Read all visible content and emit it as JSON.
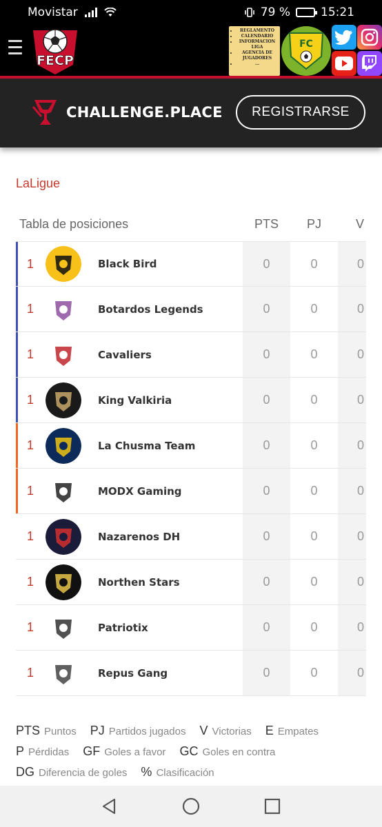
{
  "status_bar": {
    "carrier": "Movistar",
    "battery": "79 %",
    "battery_level": 0.79,
    "time": "15:21"
  },
  "header": {
    "logo_text": "FECP",
    "banner_items": [
      "REGLAMENTO",
      "CALENDARIO",
      "INFORMACION LIGA",
      "AGENCIA DE JUGADORES",
      "..."
    ],
    "badge_text": "FC",
    "brand_color": "#c8102e"
  },
  "challenge": {
    "brand": "CHALLENGE.PLACE",
    "register_label": "REGISTRARSE"
  },
  "league": {
    "title": "LaLigue"
  },
  "table": {
    "title": "Tabla de posiciones",
    "columns": [
      "PTS",
      "PJ",
      "V"
    ],
    "rows": [
      {
        "pos": "1",
        "name": "Black Bird",
        "pts": "0",
        "pj": "0",
        "v": "0",
        "zone_color": "#3f51b5",
        "logo_icon": "bird-crest-icon"
      },
      {
        "pos": "1",
        "name": "Botardos Legends",
        "pts": "0",
        "pj": "0",
        "v": "0",
        "zone_color": "#3f51b5",
        "logo_icon": "crown-crest-icon"
      },
      {
        "pos": "1",
        "name": "Cavaliers",
        "pts": "0",
        "pj": "0",
        "v": "0",
        "zone_color": "#3f51b5",
        "logo_icon": "cavs-crest-icon"
      },
      {
        "pos": "1",
        "name": "King Valkiria",
        "pts": "0",
        "pj": "0",
        "v": "0",
        "zone_color": "#3f51b5",
        "logo_icon": "valkiria-crest-icon"
      },
      {
        "pos": "1",
        "name": "La Chusma Team",
        "pts": "0",
        "pj": "0",
        "v": "0",
        "zone_color": "#f26522",
        "logo_icon": "chusma-crest-icon"
      },
      {
        "pos": "1",
        "name": "MODX Gaming",
        "pts": "0",
        "pj": "0",
        "v": "0",
        "zone_color": "#f26522",
        "logo_icon": "eagle-crest-icon"
      },
      {
        "pos": "1",
        "name": "Nazarenos DH",
        "pts": "0",
        "pj": "0",
        "v": "0",
        "zone_color": "",
        "logo_icon": "nazarenos-crest-icon"
      },
      {
        "pos": "1",
        "name": "Northen Stars",
        "pts": "0",
        "pj": "0",
        "v": "0",
        "zone_color": "",
        "logo_icon": "stars-crest-icon"
      },
      {
        "pos": "1",
        "name": "Patriotix",
        "pts": "0",
        "pj": "0",
        "v": "0",
        "zone_color": "",
        "logo_icon": "patriotix-crest-icon"
      },
      {
        "pos": "1",
        "name": "Repus Gang",
        "pts": "0",
        "pj": "0",
        "v": "0",
        "zone_color": "",
        "logo_icon": "tiger-crest-icon"
      }
    ]
  },
  "legend": [
    {
      "abbr": "PTS",
      "label": "Puntos"
    },
    {
      "abbr": "PJ",
      "label": "Partidos jugados"
    },
    {
      "abbr": "V",
      "label": "Victorias"
    },
    {
      "abbr": "E",
      "label": "Empates"
    },
    {
      "abbr": "P",
      "label": "Pérdidas"
    },
    {
      "abbr": "GF",
      "label": "Goles a favor"
    },
    {
      "abbr": "GC",
      "label": "Goles en contra"
    },
    {
      "abbr": "DG",
      "label": "Diferencia de goles"
    },
    {
      "abbr": "%",
      "label": "Clasificación"
    }
  ]
}
